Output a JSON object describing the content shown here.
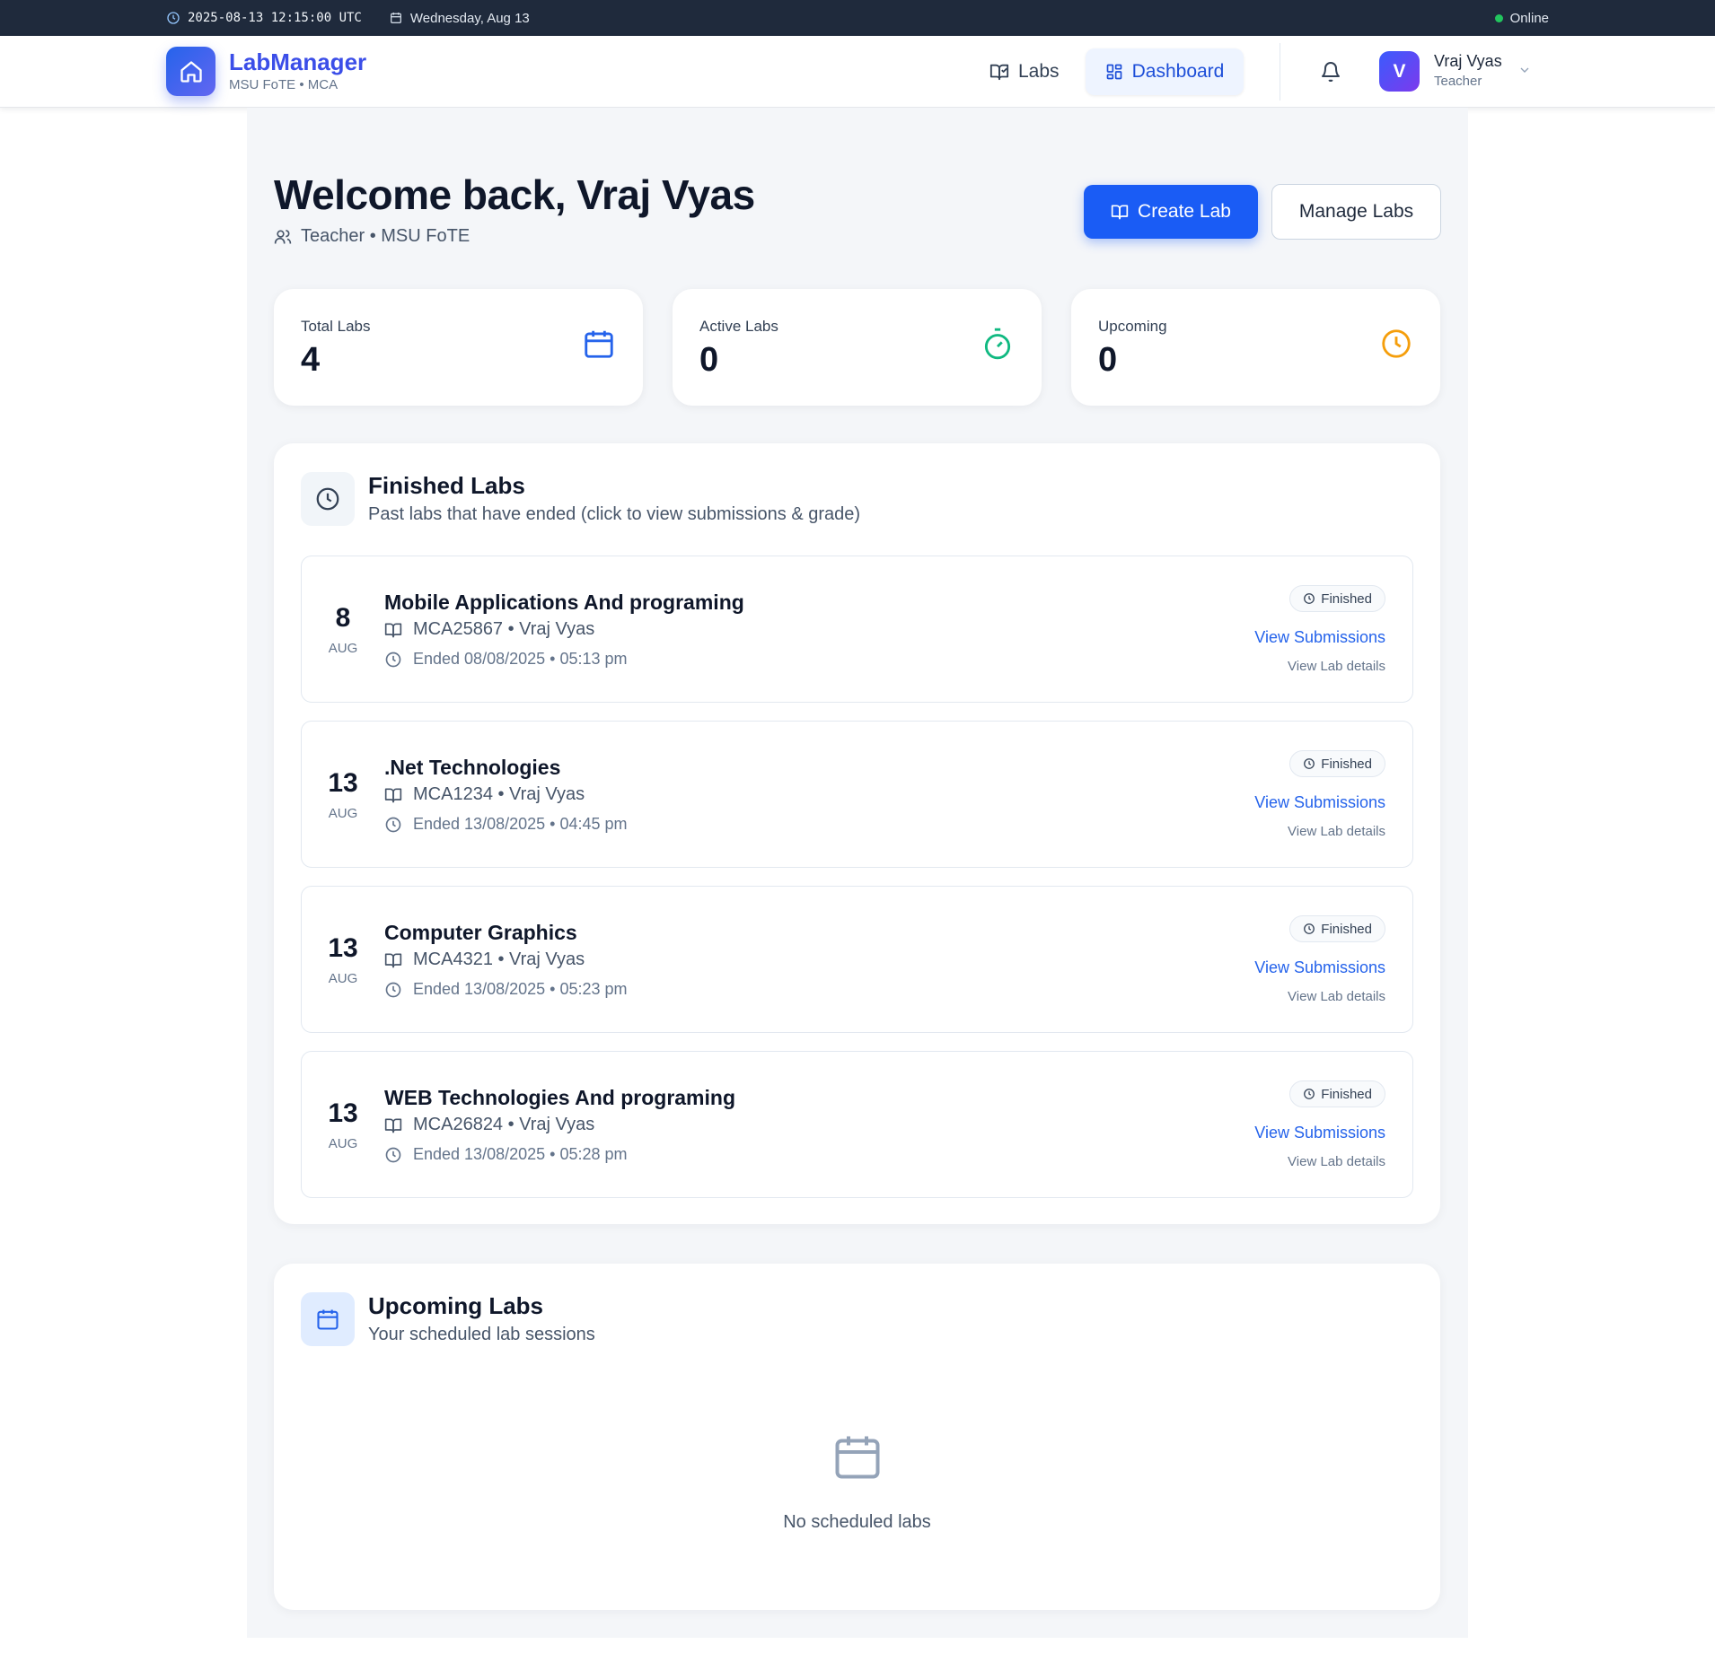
{
  "topbar": {
    "datetime": "2025-08-13 12:15:00 UTC",
    "date_label": "Wednesday, Aug 13",
    "status": "Online"
  },
  "nav": {
    "app_name": "LabManager",
    "app_sub": "MSU FoTE • MCA",
    "labs_label": "Labs",
    "dashboard_label": "Dashboard",
    "user_initial": "V",
    "user_name": "Vraj Vyas",
    "user_role": "Teacher"
  },
  "header": {
    "welcome": "Welcome back, Vraj Vyas",
    "role_line": "Teacher • MSU FoTE",
    "create_label": "Create Lab",
    "manage_label": "Manage Labs"
  },
  "stats": [
    {
      "label": "Total Labs",
      "value": "4",
      "icon": "calendar-icon",
      "color": "#2563eb"
    },
    {
      "label": "Active Labs",
      "value": "0",
      "icon": "timer-icon",
      "color": "#10b981"
    },
    {
      "label": "Upcoming",
      "value": "0",
      "icon": "clock-icon",
      "color": "#f59e0b"
    }
  ],
  "finished": {
    "title": "Finished Labs",
    "subtitle": "Past labs that have ended (click to view submissions & grade)",
    "labs": [
      {
        "day": "8",
        "month": "AUG",
        "title": "Mobile Applications And programing",
        "code_line": "MCA25867 • Vraj Vyas",
        "ended": "Ended 08/08/2025 • 05:13 pm",
        "status": "Finished",
        "view_submissions": "View Submissions",
        "view_details": "View Lab details"
      },
      {
        "day": "13",
        "month": "AUG",
        "title": ".Net Technologies",
        "code_line": "MCA1234 • Vraj Vyas",
        "ended": "Ended 13/08/2025 • 04:45 pm",
        "status": "Finished",
        "view_submissions": "View Submissions",
        "view_details": "View Lab details"
      },
      {
        "day": "13",
        "month": "AUG",
        "title": "Computer Graphics",
        "code_line": "MCA4321 • Vraj Vyas",
        "ended": "Ended 13/08/2025 • 05:23 pm",
        "status": "Finished",
        "view_submissions": "View Submissions",
        "view_details": "View Lab details"
      },
      {
        "day": "13",
        "month": "AUG",
        "title": "WEB Technologies And programing",
        "code_line": "MCA26824 • Vraj Vyas",
        "ended": "Ended 13/08/2025 • 05:28 pm",
        "status": "Finished",
        "view_submissions": "View Submissions",
        "view_details": "View Lab details"
      }
    ]
  },
  "upcoming": {
    "title": "Upcoming Labs",
    "subtitle": "Your scheduled lab sessions",
    "empty_text": "No scheduled labs"
  },
  "colors": {
    "primary": "#1a5cf5",
    "brand": "#3b4ee8",
    "online": "#22c55e"
  }
}
